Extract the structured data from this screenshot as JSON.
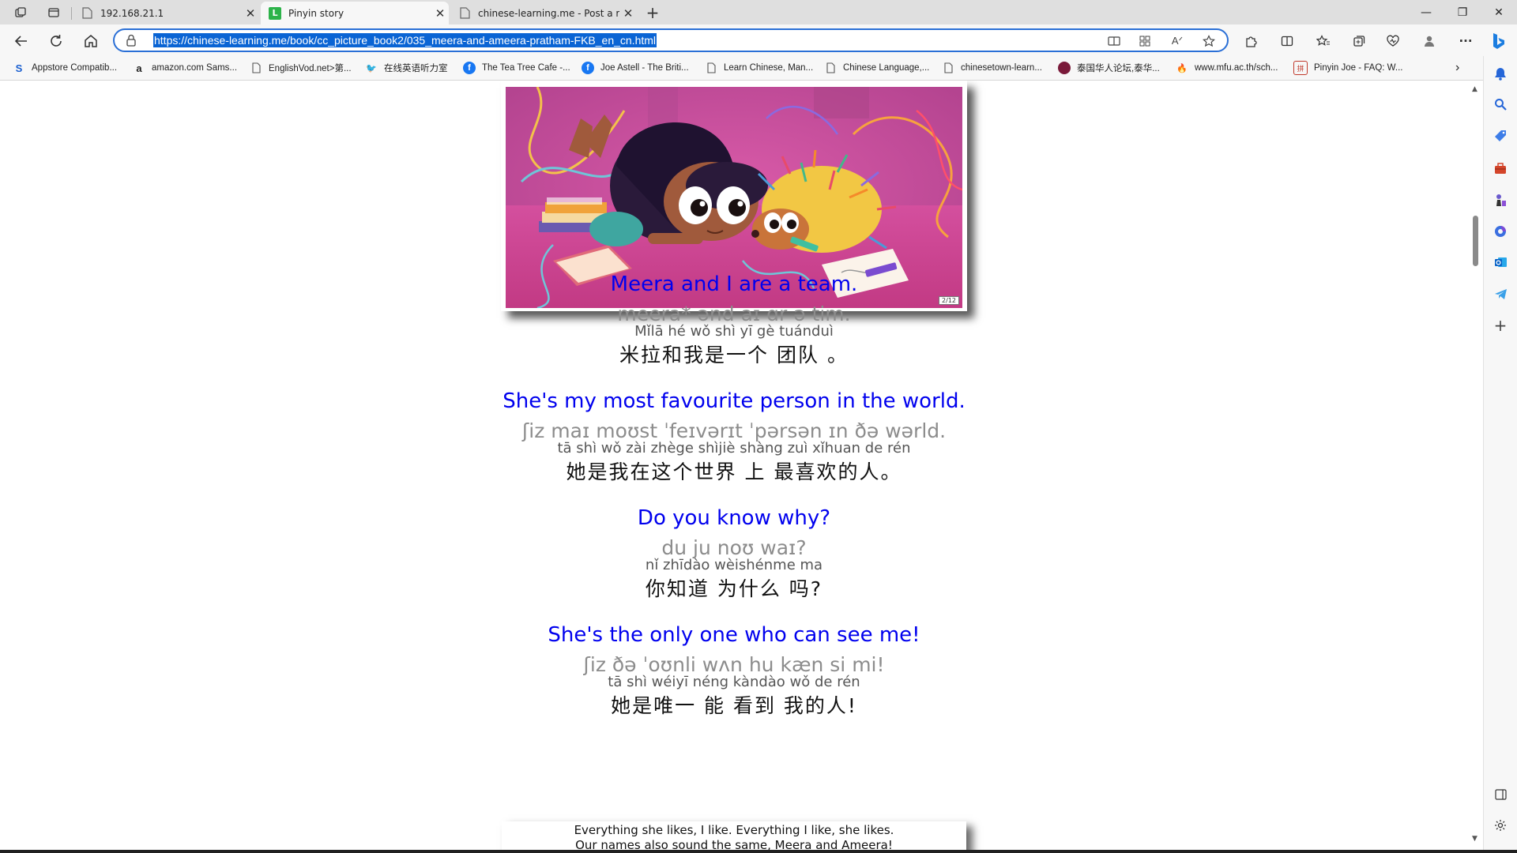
{
  "tabs": [
    {
      "title": "192.168.21.1",
      "favicon": "page-icon"
    },
    {
      "title": "Pinyin story",
      "favicon": "green-l-icon"
    },
    {
      "title": "chinese-learning.me - Post a repl",
      "favicon": "page-icon"
    }
  ],
  "address_bar": {
    "url": "https://chinese-learning.me/book/cc_picture_book2/035_meera-and-ameera-pratham-FKB_en_cn.html"
  },
  "bookmarks": [
    {
      "label": "Appstore Compatib...",
      "icon": "s-icon"
    },
    {
      "label": "amazon.com Sams...",
      "icon": "amazon-icon"
    },
    {
      "label": "EnglishVod.net>第...",
      "icon": "page-icon"
    },
    {
      "label": "在线英语听力室",
      "icon": "bird-icon"
    },
    {
      "label": "The Tea Tree Cafe -...",
      "icon": "facebook-icon"
    },
    {
      "label": "Joe Astell - The Briti...",
      "icon": "facebook-icon"
    },
    {
      "label": "Learn Chinese, Man...",
      "icon": "page-icon"
    },
    {
      "label": "Chinese Language,...",
      "icon": "page-icon"
    },
    {
      "label": "chinesetown-learn...",
      "icon": "page-icon"
    },
    {
      "label": "泰国华人论坛,泰华...",
      "icon": "forum-icon"
    },
    {
      "label": "www.mfu.ac.th/sch...",
      "icon": "flame-icon"
    },
    {
      "label": "Pinyin Joe - FAQ: W...",
      "icon": "pinyinjoe-icon"
    }
  ],
  "picture": {
    "page_badge": "2/12"
  },
  "lines": [
    {
      "en": "Meera and I are a team.",
      "ipa": "meera* ənd aɪ ɑr ə tim.",
      "pinyin": "Mǐlā  hé wǒ shì  yī  gè tuánduì",
      "zh": "米拉和我是一个 团队 。"
    },
    {
      "en": "She's my most favourite person in the world.",
      "ipa": "ʃiz maɪ moʊst ˈfeɪvərɪt ˈpərsən ɪn ðə wərld.",
      "pinyin": "tā  shì wǒ zài zhège  shìjiè  shàng zuì xǐhuan de rén",
      "zh": "她是我在这个世界 上 最喜欢的人。"
    },
    {
      "en": "Do you know why?",
      "ipa": "du ju noʊ waɪ?",
      "pinyin": "nǐ  zhīdào wèishénme ma",
      "zh": "你知道 为什么 吗?"
    },
    {
      "en": "She's the only one who can see me!",
      "ipa": "ʃiz ðə ˈoʊnli wʌn hu kæn si mi!",
      "pinyin": "tā  shì  wéiyī  néng kàndào wǒ de rén",
      "zh": "她是唯一 能 看到 我的人!"
    }
  ],
  "next_card": {
    "line1": "Everything she likes, I like. Everything I like, she likes.",
    "line2": "Our names also sound the same, Meera and Ameera!"
  },
  "colors": {
    "english_text": "#0000ee",
    "ipa_text": "#8c8c8c",
    "address_focus": "#2a6fd6",
    "picture_bg": "#c94d9c"
  }
}
